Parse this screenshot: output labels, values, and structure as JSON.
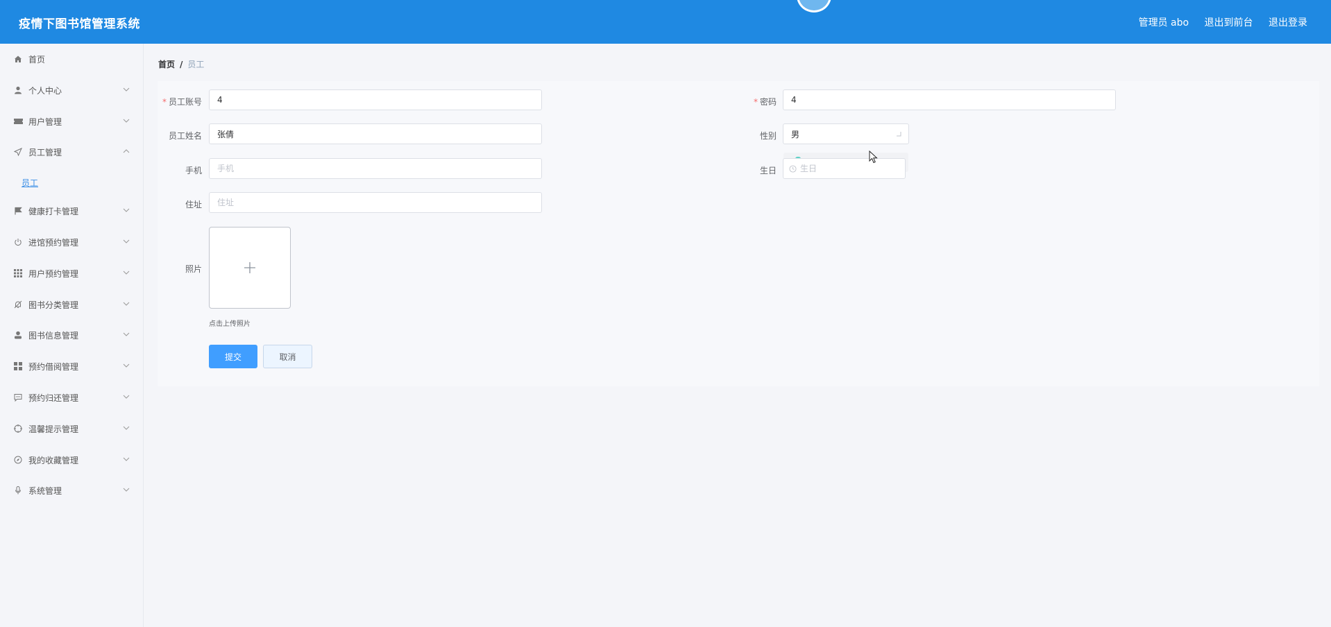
{
  "header": {
    "title": "疫情下图书馆管理系统",
    "admin_label": "管理员 abo",
    "front_label": "退出到前台",
    "logout_label": "退出登录"
  },
  "sidebar": {
    "items": [
      {
        "label": "首页",
        "icon": "home-icon"
      },
      {
        "label": "个人中心",
        "icon": "user-icon"
      },
      {
        "label": "用户管理",
        "icon": "ticket-icon"
      },
      {
        "label": "员工管理",
        "icon": "send-icon"
      },
      {
        "label": "员工",
        "icon": ""
      },
      {
        "label": "健康打卡管理",
        "icon": "flag-icon"
      },
      {
        "label": "进馆预约管理",
        "icon": "power-icon"
      },
      {
        "label": "用户预约管理",
        "icon": "grid-icon"
      },
      {
        "label": "图书分类管理",
        "icon": "bell-off-icon"
      },
      {
        "label": "图书信息管理",
        "icon": "user-filled-icon"
      },
      {
        "label": "预约借阅管理",
        "icon": "menu-icon"
      },
      {
        "label": "预约归还管理",
        "icon": "chat-icon"
      },
      {
        "label": "温馨提示管理",
        "icon": "aim-icon"
      },
      {
        "label": "我的收藏管理",
        "icon": "compass-icon"
      },
      {
        "label": "系统管理",
        "icon": "mic-icon"
      }
    ]
  },
  "breadcrumb": {
    "home": "首页",
    "separator": "/",
    "current": "员工"
  },
  "form": {
    "account_label": "员工账号",
    "account_value": "4",
    "password_label": "密码",
    "password_value": "4",
    "name_label": "员工姓名",
    "name_value": "张倩",
    "gender_label": "性别",
    "gender_value": "男",
    "phone_label": "手机",
    "phone_placeholder": "手机",
    "birthday_label": "生日",
    "birthday_placeholder": "生日",
    "address_label": "住址",
    "address_placeholder": "住址",
    "photo_label": "照片",
    "photo_tip": "点击上传照片",
    "required_mark": "*",
    "submit_label": "提交",
    "cancel_label": "取消"
  },
  "colors": {
    "header": "#1f89e2",
    "primary": "#409eff",
    "required": "#f56c6c"
  }
}
